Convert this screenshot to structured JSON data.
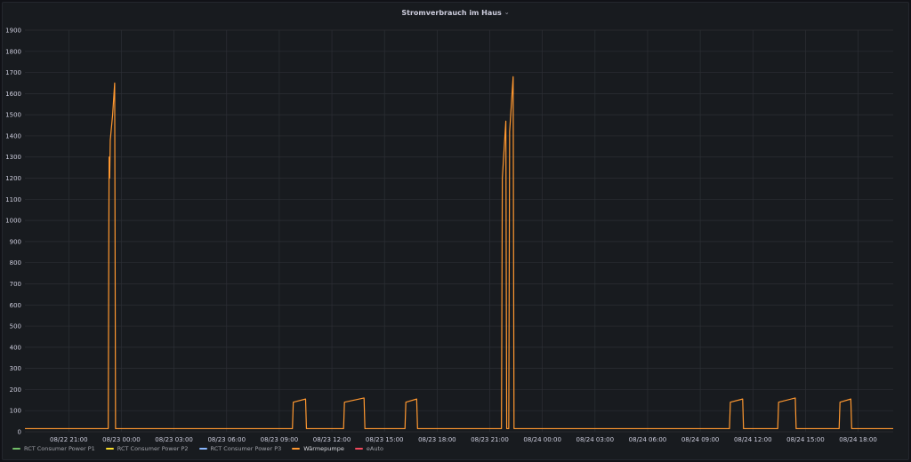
{
  "panel": {
    "title": "Stromverbrauch im Haus",
    "menu_icon": "chevron-down-icon"
  },
  "chart_data": {
    "type": "line",
    "title": "Stromverbrauch im Haus",
    "xlabel": "",
    "ylabel": "",
    "ylim": [
      0,
      1900
    ],
    "yticks": [
      0,
      100,
      200,
      300,
      400,
      500,
      600,
      700,
      800,
      900,
      1000,
      1100,
      1200,
      1300,
      1400,
      1500,
      1600,
      1700,
      1800,
      1900
    ],
    "xlim": [
      "2022-08-22T18:30",
      "2022-08-24T20:00"
    ],
    "xticks": [
      {
        "t": "2022-08-22T21:00",
        "label": "08/22 21:00"
      },
      {
        "t": "2022-08-23T00:00",
        "label": "08/23 00:00"
      },
      {
        "t": "2022-08-23T03:00",
        "label": "08/23 03:00"
      },
      {
        "t": "2022-08-23T06:00",
        "label": "08/23 06:00"
      },
      {
        "t": "2022-08-23T09:00",
        "label": "08/23 09:00"
      },
      {
        "t": "2022-08-23T12:00",
        "label": "08/23 12:00"
      },
      {
        "t": "2022-08-23T15:00",
        "label": "08/23 15:00"
      },
      {
        "t": "2022-08-23T18:00",
        "label": "08/23 18:00"
      },
      {
        "t": "2022-08-23T21:00",
        "label": "08/23 21:00"
      },
      {
        "t": "2022-08-24T00:00",
        "label": "08/24 00:00"
      },
      {
        "t": "2022-08-24T03:00",
        "label": "08/24 03:00"
      },
      {
        "t": "2022-08-24T06:00",
        "label": "08/24 06:00"
      },
      {
        "t": "2022-08-24T09:00",
        "label": "08/24 09:00"
      },
      {
        "t": "2022-08-24T12:00",
        "label": "08/24 12:00"
      },
      {
        "t": "2022-08-24T15:00",
        "label": "08/24 15:00"
      },
      {
        "t": "2022-08-24T18:00",
        "label": "08/24 18:00"
      }
    ],
    "grid": true,
    "legend_position": "bottom-left",
    "series": [
      {
        "name": "RCT Consumer Power P1",
        "color": "#73bf69",
        "points": []
      },
      {
        "name": "RCT Consumer Power P2",
        "color": "#fade2a",
        "points": []
      },
      {
        "name": "RCT Consumer Power P3",
        "color": "#8ab8ff",
        "points": []
      },
      {
        "name": "Wärmepumpe",
        "color": "#ff9830",
        "points": [
          [
            "2022-08-22T18:30",
            15
          ],
          [
            "2022-08-22T23:15",
            15
          ],
          [
            "2022-08-22T23:18",
            1300
          ],
          [
            "2022-08-22T23:20",
            1200
          ],
          [
            "2022-08-22T23:22",
            1380
          ],
          [
            "2022-08-22T23:30",
            1500
          ],
          [
            "2022-08-22T23:37",
            1650
          ],
          [
            "2022-08-22T23:40",
            15
          ],
          [
            "2022-08-23T09:45",
            15
          ],
          [
            "2022-08-23T09:48",
            140
          ],
          [
            "2022-08-23T10:30",
            155
          ],
          [
            "2022-08-23T10:33",
            15
          ],
          [
            "2022-08-23T12:40",
            15
          ],
          [
            "2022-08-23T12:43",
            140
          ],
          [
            "2022-08-23T13:50",
            160
          ],
          [
            "2022-08-23T13:53",
            15
          ],
          [
            "2022-08-23T16:10",
            15
          ],
          [
            "2022-08-23T16:13",
            140
          ],
          [
            "2022-08-23T16:50",
            155
          ],
          [
            "2022-08-23T16:53",
            15
          ],
          [
            "2022-08-23T21:40",
            15
          ],
          [
            "2022-08-23T21:43",
            1200
          ],
          [
            "2022-08-23T21:55",
            1470
          ],
          [
            "2022-08-23T21:58",
            15
          ],
          [
            "2022-08-23T22:05",
            15
          ],
          [
            "2022-08-23T22:08",
            1420
          ],
          [
            "2022-08-23T22:20",
            1680
          ],
          [
            "2022-08-23T22:23",
            15
          ],
          [
            "2022-08-24T10:40",
            15
          ],
          [
            "2022-08-24T10:43",
            140
          ],
          [
            "2022-08-24T11:25",
            155
          ],
          [
            "2022-08-24T11:28",
            15
          ],
          [
            "2022-08-24T13:25",
            15
          ],
          [
            "2022-08-24T13:28",
            140
          ],
          [
            "2022-08-24T14:25",
            160
          ],
          [
            "2022-08-24T14:28",
            15
          ],
          [
            "2022-08-24T16:55",
            15
          ],
          [
            "2022-08-24T16:58",
            140
          ],
          [
            "2022-08-24T17:35",
            155
          ],
          [
            "2022-08-24T17:38",
            15
          ],
          [
            "2022-08-24T20:00",
            15
          ]
        ]
      },
      {
        "name": "eAuto",
        "color": "#f2495c",
        "points": []
      }
    ]
  },
  "colors": {
    "background": "#111217",
    "panel": "#181b1f",
    "grid": "#2c2f35",
    "axis_text": "#ccccdc"
  }
}
